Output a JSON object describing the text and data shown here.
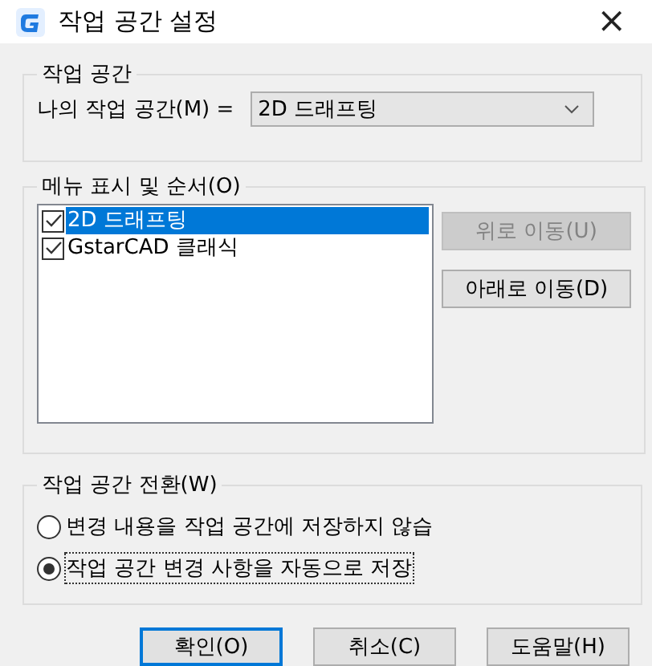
{
  "window": {
    "title": "작업 공간 설정",
    "close": "×"
  },
  "workspace_group": {
    "legend": "작업 공간",
    "label": "나의 작업 공간(M) =",
    "dropdown": {
      "value": "2D 드래프팅"
    }
  },
  "menu_group": {
    "legend": "메뉴 표시 및 순서(O)",
    "items": [
      {
        "label": "2D 드래프팅",
        "checked": true,
        "selected": true
      },
      {
        "label": "GstarCAD 클래식",
        "checked": true,
        "selected": false
      }
    ],
    "buttons": [
      {
        "label": "위로 이동(U)",
        "disabled": true
      },
      {
        "label": "아래로 이동(D)",
        "disabled": false
      }
    ]
  },
  "switch_group": {
    "legend": "작업 공간 전환(W)",
    "options": [
      {
        "label": "변경 내용을 작업 공간에 저장하지 않습",
        "selected": false
      },
      {
        "label": "작업 공간 변경 사항을 자동으로 저장",
        "selected": true
      }
    ]
  },
  "buttons": [
    {
      "label": "확인(O)",
      "default": true
    },
    {
      "label": "취소(C)",
      "default": false
    },
    {
      "label": "도움말(H)",
      "default": false
    }
  ]
}
